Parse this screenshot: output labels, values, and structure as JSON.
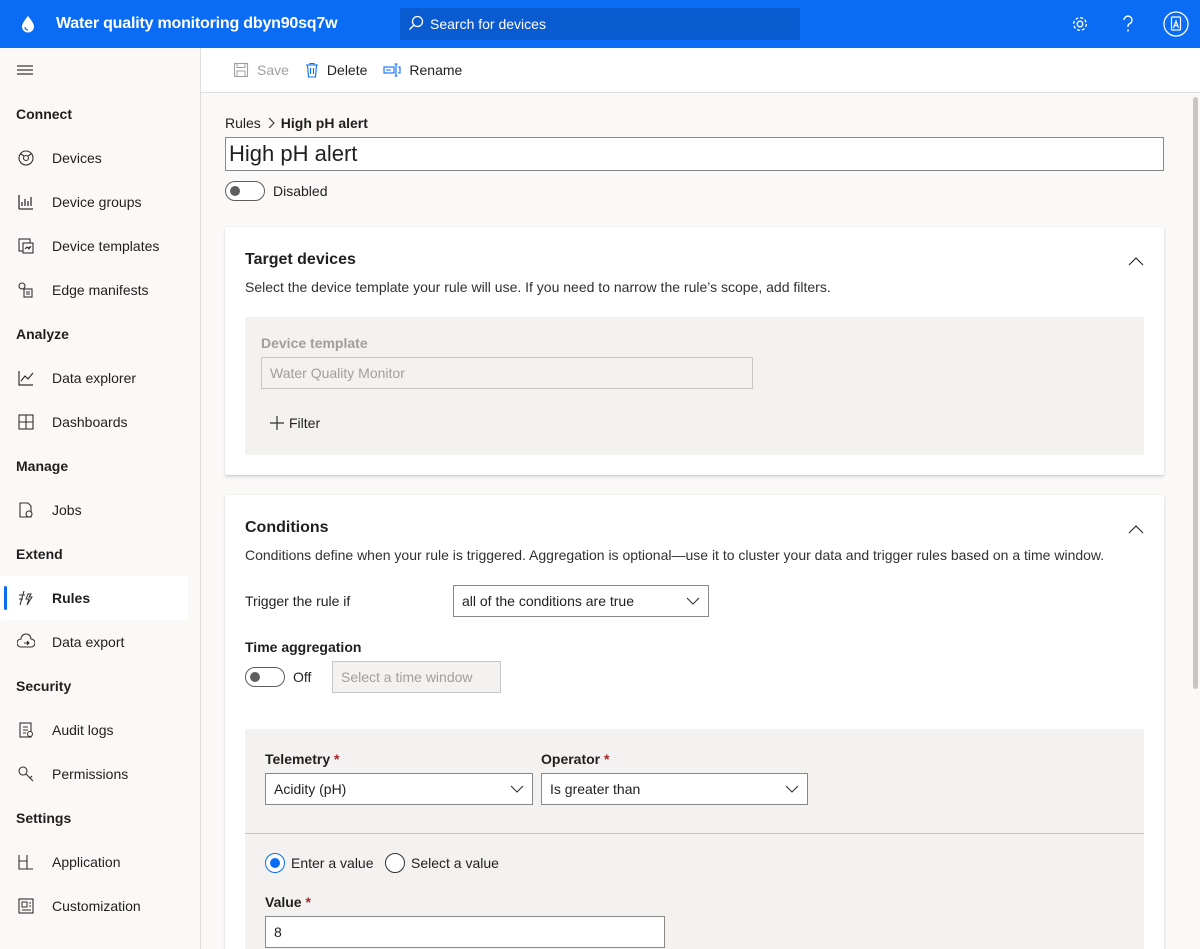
{
  "header": {
    "app_title": "Water quality monitoring dbyn90sq7w",
    "search_placeholder": "Search for devices",
    "brand_color": "#0a6cf5"
  },
  "sidebar": {
    "sections": [
      {
        "title": "Connect",
        "items": [
          {
            "label": "Devices",
            "icon": "devices-icon"
          },
          {
            "label": "Device groups",
            "icon": "device-groups-icon"
          },
          {
            "label": "Device templates",
            "icon": "device-templates-icon"
          },
          {
            "label": "Edge manifests",
            "icon": "edge-manifests-icon"
          }
        ]
      },
      {
        "title": "Analyze",
        "items": [
          {
            "label": "Data explorer",
            "icon": "data-explorer-icon"
          },
          {
            "label": "Dashboards",
            "icon": "dashboards-icon"
          }
        ]
      },
      {
        "title": "Manage",
        "items": [
          {
            "label": "Jobs",
            "icon": "jobs-icon"
          }
        ]
      },
      {
        "title": "Extend",
        "items": [
          {
            "label": "Rules",
            "icon": "rules-icon",
            "active": true
          },
          {
            "label": "Data export",
            "icon": "data-export-icon"
          }
        ]
      },
      {
        "title": "Security",
        "items": [
          {
            "label": "Audit logs",
            "icon": "audit-logs-icon"
          },
          {
            "label": "Permissions",
            "icon": "permissions-icon"
          }
        ]
      },
      {
        "title": "Settings",
        "items": [
          {
            "label": "Application",
            "icon": "application-icon"
          },
          {
            "label": "Customization",
            "icon": "customization-icon"
          }
        ]
      }
    ]
  },
  "commandbar": {
    "save": "Save",
    "delete": "Delete",
    "rename": "Rename"
  },
  "breadcrumb": {
    "parent": "Rules",
    "current": "High pH alert"
  },
  "rule": {
    "name": "High pH alert",
    "status": "Disabled"
  },
  "target_devices": {
    "title": "Target devices",
    "description": "Select the device template your rule will use. If you need to narrow the rule’s scope, add filters.",
    "template_label": "Device template",
    "template_value": "Water Quality Monitor",
    "filter_label": "Filter"
  },
  "conditions": {
    "title": "Conditions",
    "description": "Conditions define when your rule is triggered. Aggregation is optional—use it to cluster your data and trigger rules based on a time window.",
    "trigger_label": "Trigger the rule if",
    "trigger_value": "all of the conditions are true",
    "time_aggregation_label": "Time aggregation",
    "time_aggregation_state": "Off",
    "time_window_placeholder": "Select a time window",
    "telemetry_label": "Telemetry",
    "telemetry_value": "Acidity (pH)",
    "operator_label": "Operator",
    "operator_value": "Is greater than",
    "required_mark": "*",
    "enter_value_label": "Enter a value",
    "select_value_label": "Select a value",
    "value_label": "Value",
    "value": "8"
  }
}
